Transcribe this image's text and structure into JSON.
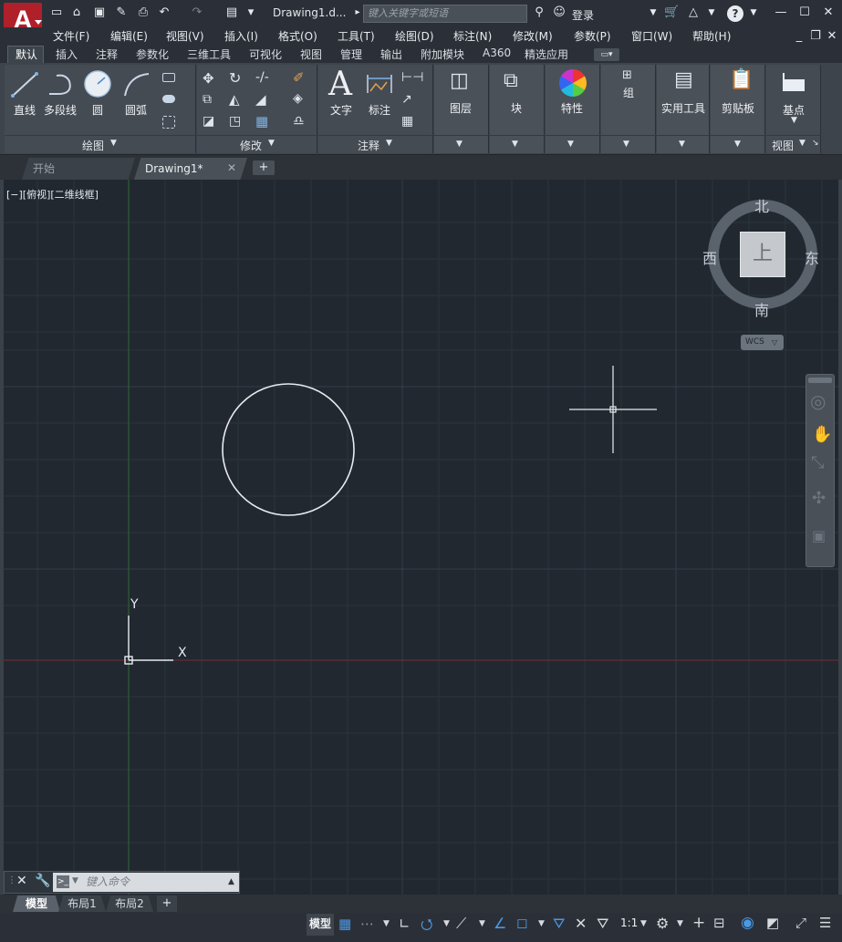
{
  "app": {
    "logo_letter": "A",
    "title": "Drawing1.d...",
    "search_placeholder": "键入关键字或短语",
    "login_label": "登录",
    "help_label": "?"
  },
  "menus": [
    "文件(F)",
    "编辑(E)",
    "视图(V)",
    "插入(I)",
    "格式(O)",
    "工具(T)",
    "绘图(D)",
    "标注(N)",
    "修改(M)",
    "参数(P)",
    "窗口(W)",
    "帮助(H)"
  ],
  "ribbon_tabs": [
    "默认",
    "插入",
    "注释",
    "参数化",
    "三维工具",
    "可视化",
    "视图",
    "管理",
    "输出",
    "附加模块",
    "A360",
    "精选应用"
  ],
  "active_ribbon_tab": "默认",
  "ribbon": {
    "draw_panel": "绘图",
    "modify_panel": "修改",
    "annotate_panel": "注释",
    "view_panel": "视图",
    "buttons": {
      "line": "直线",
      "polyline": "多段线",
      "circle": "圆",
      "arc": "圆弧",
      "text": "文字",
      "dimension": "标注",
      "layers": "图层",
      "block": "块",
      "properties": "特性",
      "groups": "组",
      "utilities": "实用工具",
      "clipboard": "剪贴板",
      "base_point": "基点"
    }
  },
  "doc_tabs": {
    "start": "开始",
    "drawing": "Drawing1*",
    "new": "+"
  },
  "viewport": {
    "label": "[−][俯视][二维线框]",
    "ucs_x": "X",
    "ucs_y": "Y"
  },
  "viewcube": {
    "north": "北",
    "south": "南",
    "east": "东",
    "west": "西",
    "face": "上",
    "wcs": "WCS"
  },
  "command_line": {
    "placeholder": "键入命令"
  },
  "layout_tabs": [
    "模型",
    "布局1",
    "布局2"
  ],
  "layout_add": "+",
  "status": {
    "model": "模型",
    "scale": "1:1"
  },
  "colors": {
    "canvas": "#212830",
    "accent_red": "#b0202a",
    "x_axis": "#7a2a30",
    "y_axis": "#2f6a34"
  }
}
